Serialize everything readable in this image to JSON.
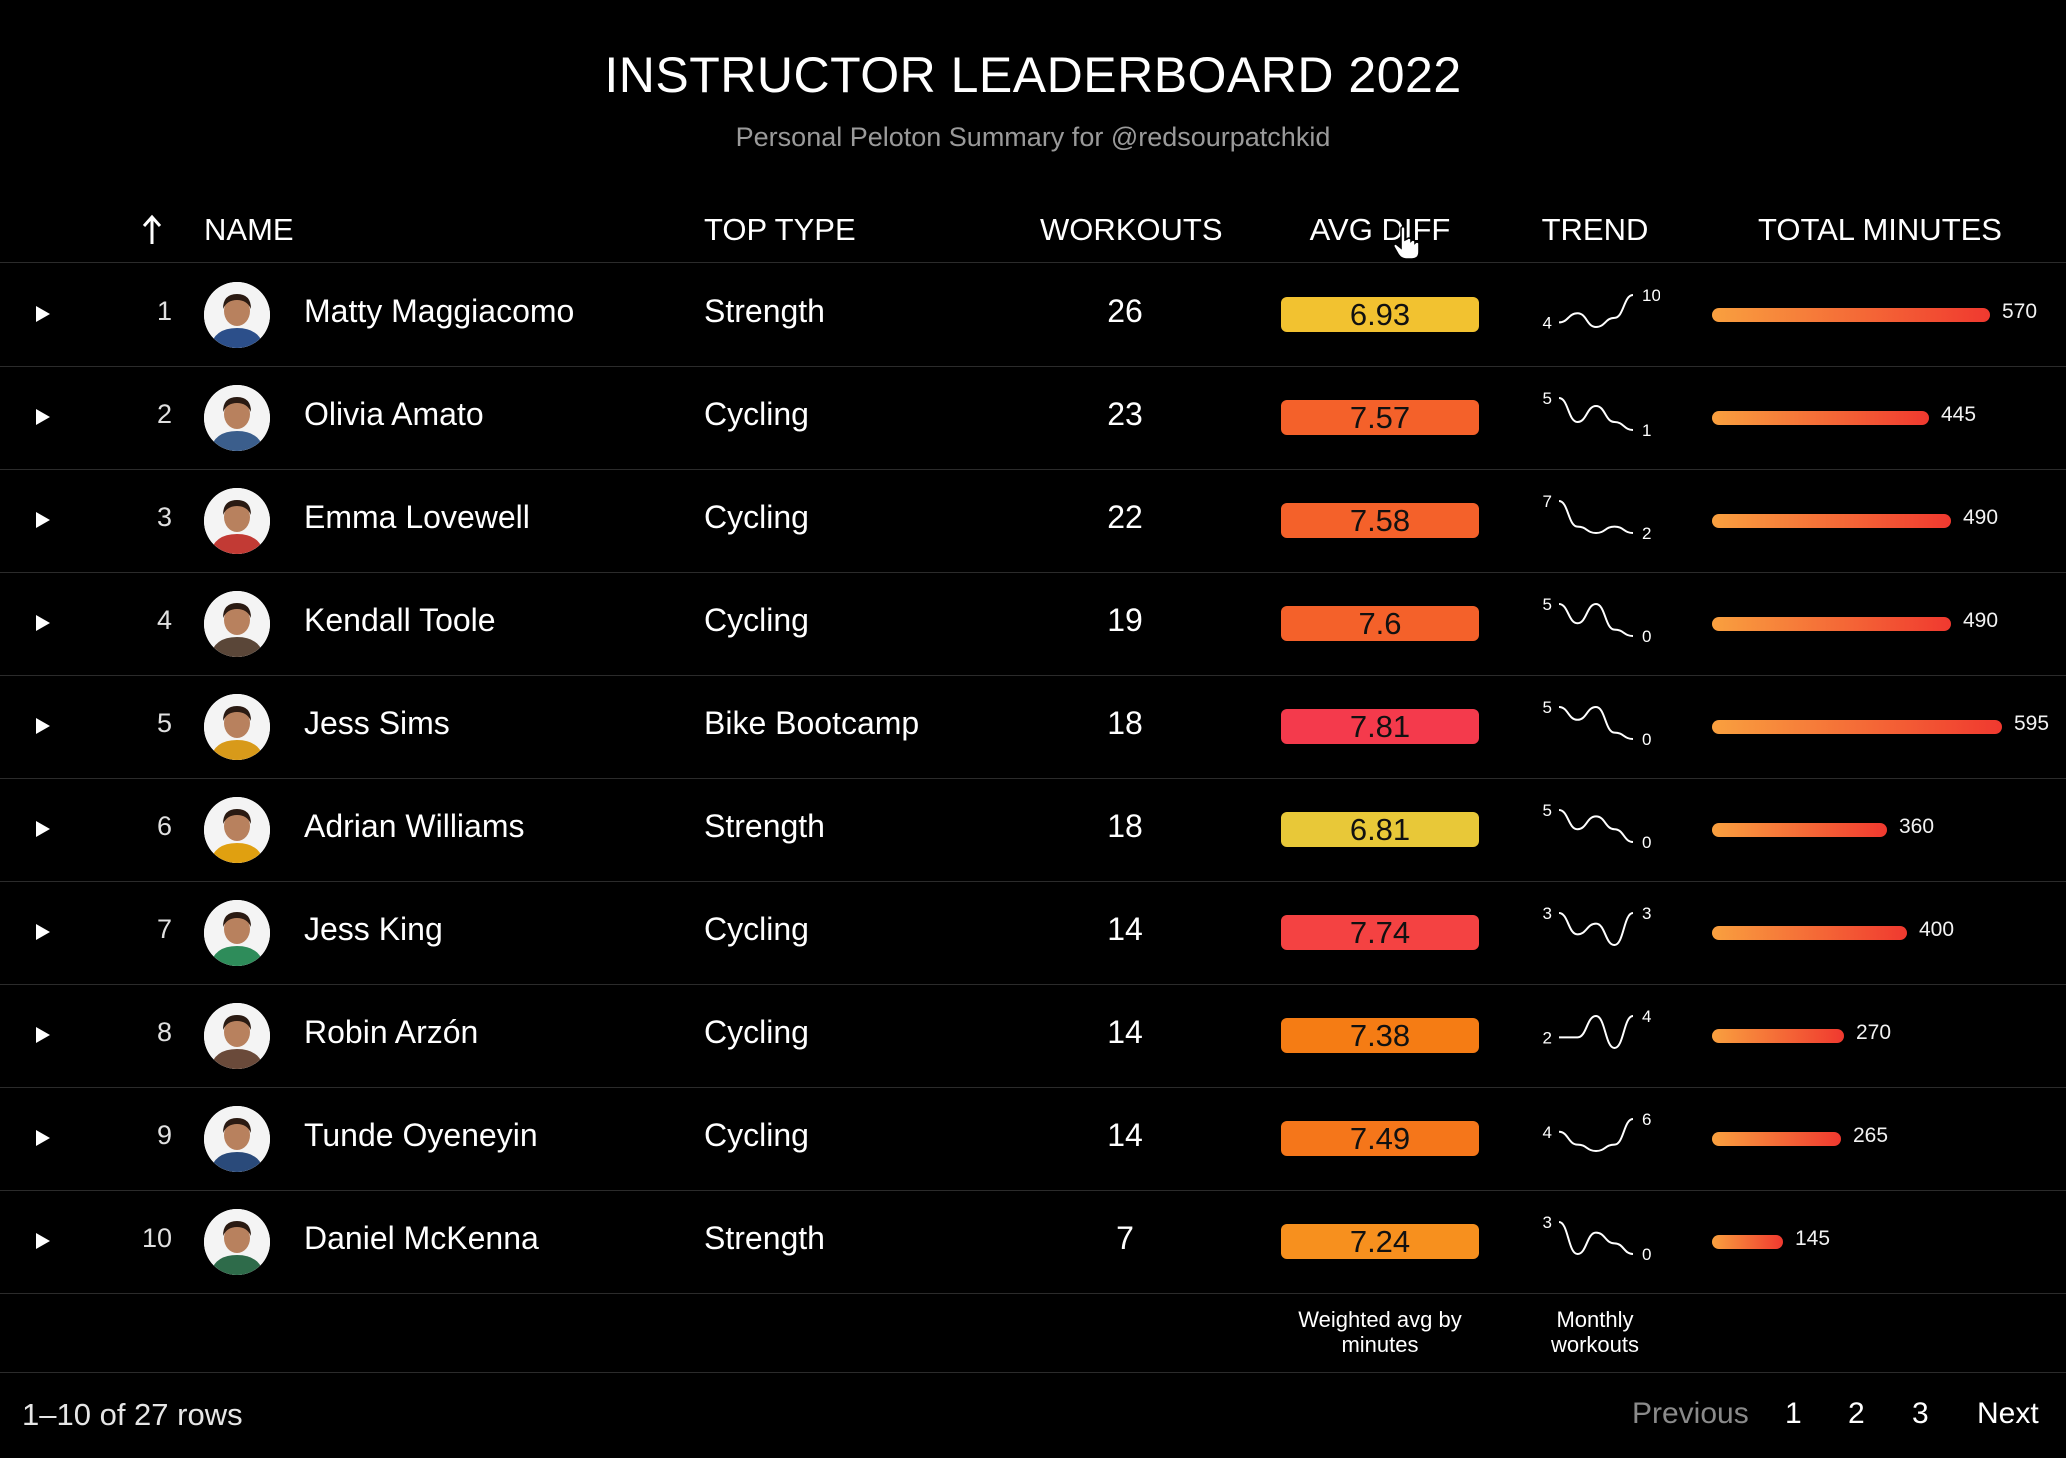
{
  "header": {
    "title": "INSTRUCTOR LEADERBOARD 2022",
    "subtitle": "Personal Peloton Summary for @redsourpatchkid"
  },
  "columns": {
    "name": "NAME",
    "top_type": "TOP TYPE",
    "workouts": "WORKOUTS",
    "avg_diff": "AVG DIFF",
    "trend": "TREND",
    "total_minutes": "TOTAL MINUTES"
  },
  "icons": {
    "sort": "up-arrow-icon",
    "expand": "play-triangle-icon",
    "cursor": "hand-pointer-icon"
  },
  "rows": [
    {
      "rank": "1",
      "name": "Matty Maggiacomo",
      "top_type": "Strength",
      "workouts": "26",
      "avg_diff": "6.93",
      "diff_color": "#f2c230",
      "trend_start": "4",
      "trend_end": "10",
      "trend": [
        4,
        6,
        3,
        5,
        10
      ],
      "minutes": 570,
      "minutes_label": "570",
      "avatar_color": "#2c4f8a"
    },
    {
      "rank": "2",
      "name": "Olivia Amato",
      "top_type": "Cycling",
      "workouts": "23",
      "avg_diff": "7.57",
      "diff_color": "#f4612a",
      "trend_start": "5",
      "trend_end": "1",
      "trend": [
        5,
        2,
        4,
        2,
        1
      ],
      "minutes": 445,
      "minutes_label": "445",
      "avatar_color": "#3b5e8c"
    },
    {
      "rank": "3",
      "name": "Emma Lovewell",
      "top_type": "Cycling",
      "workouts": "22",
      "avg_diff": "7.58",
      "diff_color": "#f4612a",
      "trend_start": "7",
      "trend_end": "2",
      "trend": [
        7,
        3,
        2,
        3,
        2
      ],
      "minutes": 490,
      "minutes_label": "490",
      "avatar_color": "#c23a34"
    },
    {
      "rank": "4",
      "name": "Kendall Toole",
      "top_type": "Cycling",
      "workouts": "19",
      "avg_diff": "7.6",
      "diff_color": "#f4612a",
      "trend_start": "5",
      "trend_end": "0",
      "trend": [
        5,
        2,
        5,
        1,
        0
      ],
      "minutes": 490,
      "minutes_label": "490",
      "avatar_color": "#5a4638"
    },
    {
      "rank": "5",
      "name": "Jess Sims",
      "top_type": "Bike Bootcamp",
      "workouts": "18",
      "avg_diff": "7.81",
      "diff_color": "#f43a4c",
      "trend_start": "5",
      "trend_end": "0",
      "trend": [
        5,
        3,
        5,
        1,
        0
      ],
      "minutes": 595,
      "minutes_label": "595",
      "avatar_color": "#d89a1a"
    },
    {
      "rank": "6",
      "name": "Adrian Williams",
      "top_type": "Strength",
      "workouts": "18",
      "avg_diff": "6.81",
      "diff_color": "#e8c838",
      "trend_start": "5",
      "trend_end": "0",
      "trend": [
        5,
        2,
        4,
        2,
        0
      ],
      "minutes": 360,
      "minutes_label": "360",
      "avatar_color": "#e0a010"
    },
    {
      "rank": "7",
      "name": "Jess King",
      "top_type": "Cycling",
      "workouts": "14",
      "avg_diff": "7.74",
      "diff_color": "#f44242",
      "trend_start": "3",
      "trend_end": "3",
      "trend": [
        3,
        1,
        2,
        0,
        3
      ],
      "minutes": 400,
      "minutes_label": "400",
      "avatar_color": "#2e8c5a"
    },
    {
      "rank": "8",
      "name": "Robin Arzón",
      "top_type": "Cycling",
      "workouts": "14",
      "avg_diff": "7.38",
      "diff_color": "#f57c14",
      "trend_start": "2",
      "trend_end": "4",
      "trend": [
        2,
        2,
        4,
        1,
        4
      ],
      "minutes": 270,
      "minutes_label": "270",
      "avatar_color": "#6a4a3a"
    },
    {
      "rank": "9",
      "name": "Tunde Oyeneyin",
      "top_type": "Cycling",
      "workouts": "14",
      "avg_diff": "7.49",
      "diff_color": "#f5761a",
      "trend_start": "4",
      "trend_end": "6",
      "trend": [
        4,
        2,
        1,
        2,
        6
      ],
      "minutes": 265,
      "minutes_label": "265",
      "avatar_color": "#2a4a7a"
    },
    {
      "rank": "10",
      "name": "Daniel McKenna",
      "top_type": "Strength",
      "workouts": "7",
      "avg_diff": "7.24",
      "diff_color": "#f7901e",
      "trend_start": "3",
      "trend_end": "0",
      "trend": [
        3,
        0,
        2,
        1,
        0
      ],
      "minutes": 145,
      "minutes_label": "145",
      "avatar_color": "#2e6b4a"
    }
  ],
  "footnotes": {
    "avg_diff": "Weighted avg by minutes",
    "trend": "Monthly workouts"
  },
  "pagination": {
    "summary": "1–10 of 27 rows",
    "previous": "Previous",
    "pages": [
      "1",
      "2",
      "3"
    ],
    "next": "Next"
  }
}
